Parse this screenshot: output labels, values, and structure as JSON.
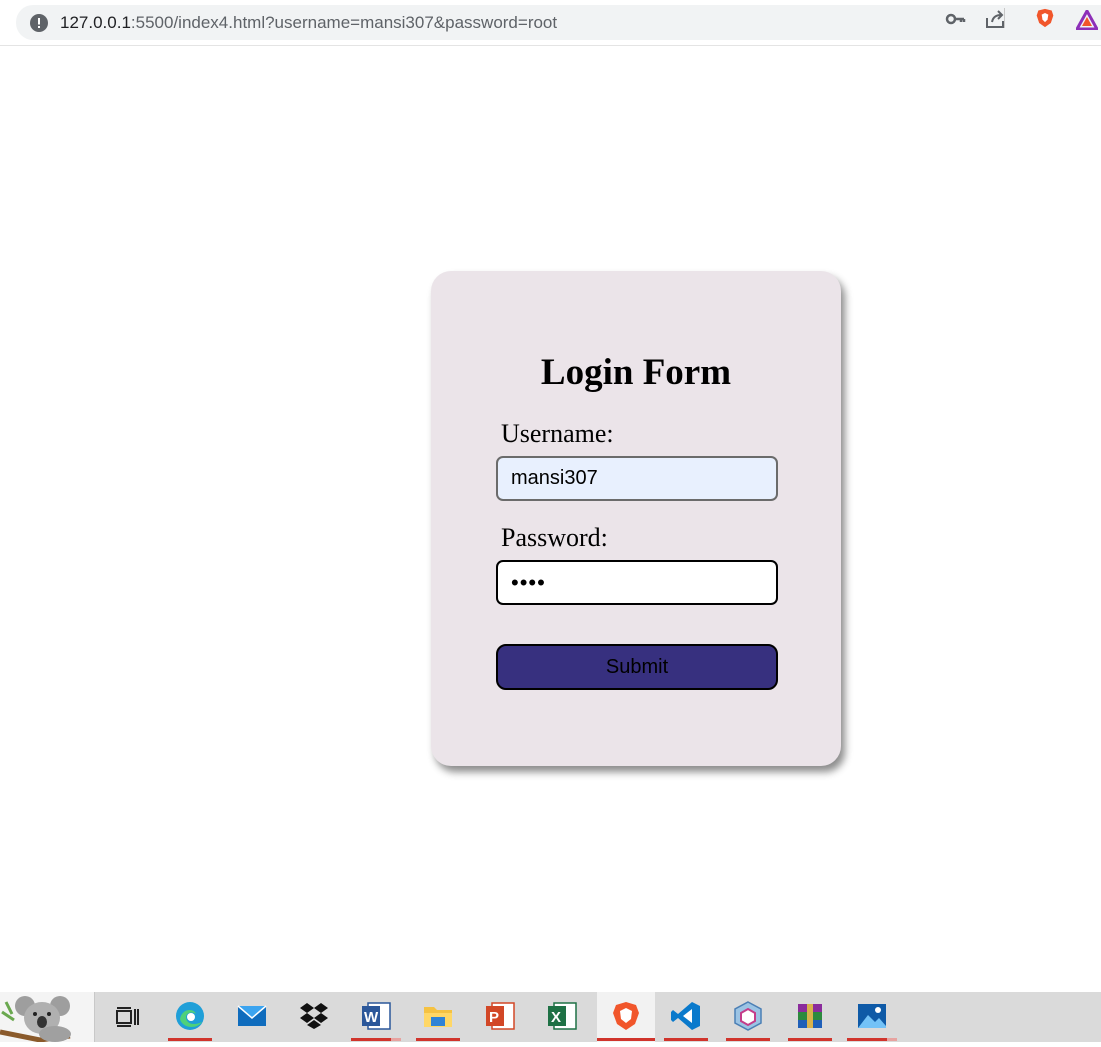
{
  "browser": {
    "url_host": "127.0.0.1",
    "url_rest": ":5500/index4.html?username=mansi307&password=root",
    "icons": [
      "not-secure-icon",
      "key-icon",
      "share-icon",
      "brave-shield-icon",
      "brave-rewards-icon"
    ]
  },
  "form": {
    "title": "Login Form",
    "username_label": "Username:",
    "username_value": "mansi307",
    "password_label": "Password:",
    "password_mask": "••••",
    "submit_label": "Submit"
  },
  "taskbar": {
    "apps": [
      "koala-wallpaper",
      "task-view",
      "edge",
      "mail",
      "dropbox",
      "word",
      "file-explorer",
      "powerpoint",
      "excel",
      "brave",
      "vscode",
      "virtualbox",
      "winrar",
      "photos"
    ]
  },
  "colors": {
    "card_bg": "#ebe4e9",
    "button_bg": "#37307f",
    "autofill_bg": "#e8f0fe",
    "taskbar_bg": "#dadada"
  }
}
